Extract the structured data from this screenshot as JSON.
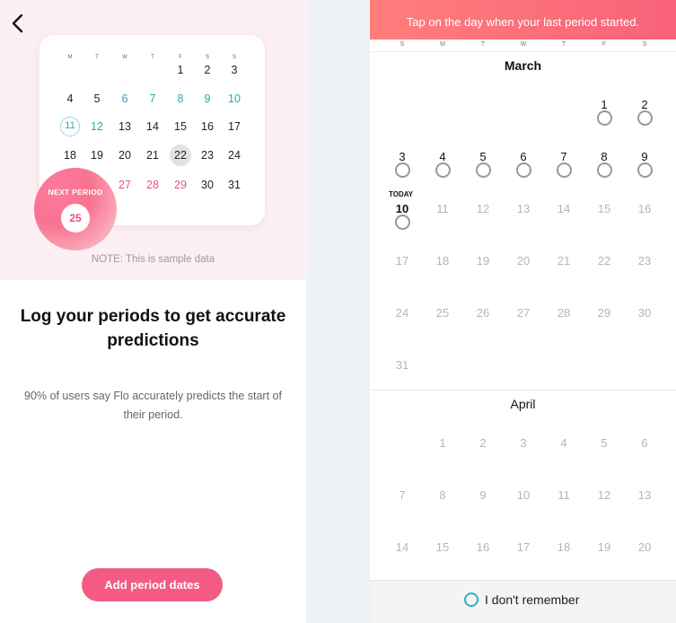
{
  "left": {
    "mini_calendar": {
      "weekdays": [
        "M",
        "T",
        "W",
        "T",
        "F",
        "S",
        "S"
      ],
      "rows": [
        [
          "",
          "",
          "",
          "",
          "1",
          "2",
          "3"
        ],
        [
          "4",
          "5",
          "6",
          "7",
          "8",
          "9",
          "10"
        ],
        [
          "11",
          "12",
          "13",
          "14",
          "15",
          "16",
          "17"
        ],
        [
          "18",
          "19",
          "20",
          "21",
          "22",
          "23",
          "24"
        ],
        [
          "",
          "",
          "27",
          "28",
          "29",
          "30",
          "31"
        ]
      ]
    },
    "next_period": {
      "label": "NEXT PERIOD",
      "day": "25"
    },
    "note": "NOTE: This is sample data",
    "headline": "Log your periods to get accurate predictions",
    "subtext": "90% of users say Flo accurately predicts the start of their period.",
    "add_button": "Add period dates"
  },
  "right": {
    "banner": "Tap on the day when your last period started.",
    "weekdays": [
      "S",
      "M",
      "T",
      "W",
      "T",
      "F",
      "S"
    ],
    "months": [
      {
        "name": "March",
        "rows": [
          [
            "",
            "",
            "",
            "",
            "",
            "1",
            "2"
          ],
          [
            "3",
            "4",
            "5",
            "6",
            "7",
            "8",
            "9"
          ],
          [
            "10",
            "11",
            "12",
            "13",
            "14",
            "15",
            "16"
          ],
          [
            "17",
            "18",
            "19",
            "20",
            "21",
            "22",
            "23"
          ],
          [
            "24",
            "25",
            "26",
            "27",
            "28",
            "29",
            "30"
          ],
          [
            "31",
            "",
            "",
            "",
            "",
            "",
            ""
          ]
        ]
      },
      {
        "name": "April",
        "rows": [
          [
            "",
            "1",
            "2",
            "3",
            "4",
            "5",
            "6"
          ],
          [
            "7",
            "8",
            "9",
            "10",
            "11",
            "12",
            "13"
          ],
          [
            "14",
            "15",
            "16",
            "17",
            "18",
            "19",
            "20"
          ]
        ]
      }
    ],
    "today_label": "TODAY",
    "dont_remember": "I don't remember"
  },
  "colors": {
    "accent_pink": "#f35a84",
    "teal": "#2aa9b0"
  },
  "icons": {
    "back": "chevron-left-icon"
  }
}
